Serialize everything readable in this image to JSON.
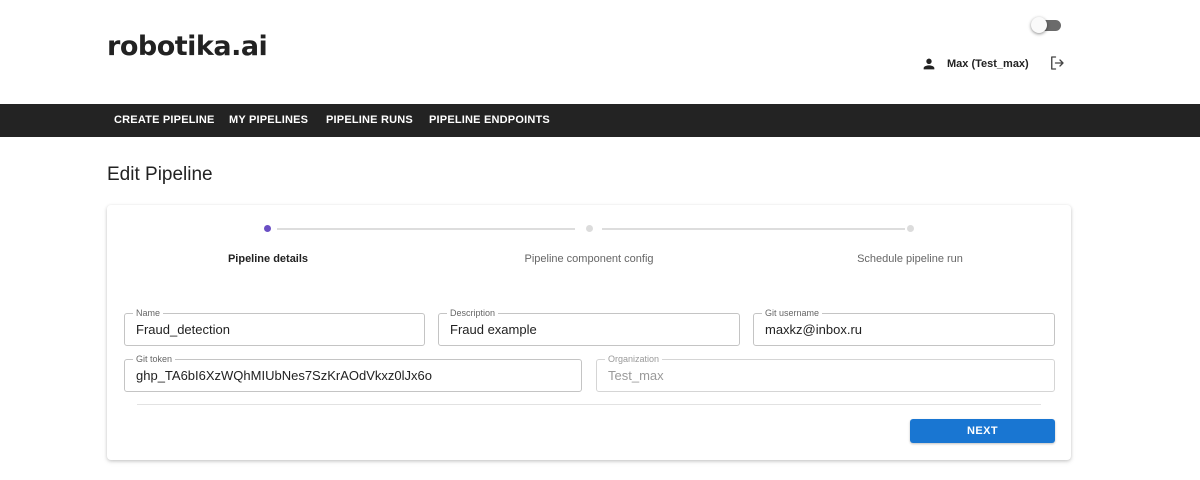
{
  "header": {
    "logo": "robotika.ai",
    "user_name": "Max (Test_max)"
  },
  "navbar": {
    "items": [
      {
        "label": "CREATE PIPELINE"
      },
      {
        "label": "MY PIPELINES"
      },
      {
        "label": "PIPELINE RUNS"
      },
      {
        "label": "PIPELINE ENDPOINTS"
      }
    ]
  },
  "page": {
    "title": "Edit Pipeline"
  },
  "stepper": {
    "active_step": 1,
    "steps": [
      {
        "label": "Pipeline details"
      },
      {
        "label": "Pipeline component config"
      },
      {
        "label": "Schedule pipeline run"
      }
    ]
  },
  "form": {
    "name": {
      "label": "Name",
      "value": "Fraud_detection"
    },
    "description": {
      "label": "Description",
      "value": "Fraud example"
    },
    "git_username": {
      "label": "Git username",
      "value": "maxkz@inbox.ru"
    },
    "git_token": {
      "label": "Git token",
      "value": "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"
    },
    "organization": {
      "label": "Organization",
      "value": "Test_max",
      "disabled": true
    }
  },
  "actions": {
    "next_label": "NEXT"
  },
  "colors": {
    "navbar_bg": "#232323",
    "accent_primary": "#1976d2",
    "stepper_active": "#6a4fc4"
  },
  "icons": {
    "user": "person-icon",
    "logout": "logout-icon",
    "theme": "theme-toggle"
  }
}
